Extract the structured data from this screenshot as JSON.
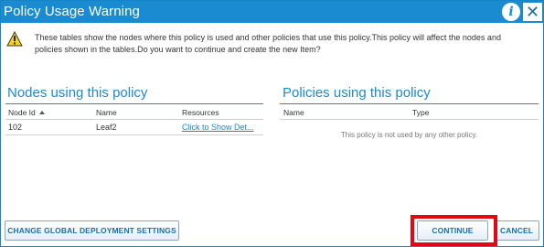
{
  "dialog": {
    "title": "Policy Usage Warning",
    "warning_text": "These tables show the nodes where this policy is used and other policies that use this policy.This policy will affect the nodes and policies shown in the tables.Do you want to continue and create the new Item?"
  },
  "nodes_section": {
    "title": "Nodes using this policy",
    "columns": [
      "Node Id",
      "Name",
      "Resources"
    ],
    "rows": [
      {
        "node_id": "102",
        "name": "Leaf2",
        "resources": "Click to Show Det..."
      }
    ]
  },
  "policies_section": {
    "title": "Policies using this policy",
    "columns": [
      "Name",
      "Type"
    ],
    "empty_message": "This policy is not used by any other policy."
  },
  "buttons": {
    "change_global": "CHANGE GLOBAL DEPLOYMENT SETTINGS",
    "continue": "CONTINUE",
    "cancel": "CANCEL"
  },
  "icons": {
    "info": "info-icon",
    "close": "close-icon",
    "warning": "warning-icon",
    "sort": "sort-ascending-icon"
  },
  "colors": {
    "accent": "#1a8bd0",
    "highlight": "#e30613"
  }
}
